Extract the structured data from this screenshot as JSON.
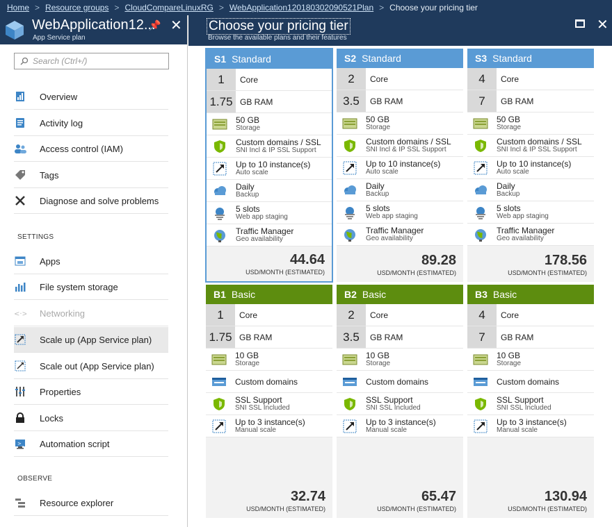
{
  "breadcrumb": {
    "items": [
      "Home",
      "Resource groups",
      "CloudCompareLinuxRG",
      "WebApplication120180302090521Plan"
    ],
    "current": "Choose your pricing tier"
  },
  "left_panel": {
    "title": "WebApplication12...",
    "subtitle": "App Service plan",
    "search_placeholder": "Search (Ctrl+/)",
    "nav": [
      "Overview",
      "Activity log",
      "Access control (IAM)",
      "Tags",
      "Diagnose and solve problems"
    ],
    "settings_label": "SETTINGS",
    "settings": [
      "Apps",
      "File system storage",
      "Networking",
      "Scale up (App Service plan)",
      "Scale out (App Service plan)",
      "Properties",
      "Locks",
      "Automation script"
    ],
    "observe_label": "OBSERVE",
    "observe": [
      "Resource explorer"
    ]
  },
  "right_panel": {
    "title": "Choose your pricing tier",
    "subtitle": "Browse the available plans and their features"
  },
  "colors": {
    "standard": "#5a9bd5",
    "basic": "#5d8d0f",
    "header": "#1f3a5c"
  },
  "standard_features": [
    {
      "t1": "Custom domains / SSL",
      "t2": "SNI Incl & IP SSL Support",
      "icon": "shield-icon"
    },
    {
      "t1": "Up to 10 instance(s)",
      "t2": "Auto scale",
      "icon": "scale-icon"
    },
    {
      "t1": "Daily",
      "t2": "Backup",
      "icon": "cloud-backup-icon"
    },
    {
      "t1": "5 slots",
      "t2": "Web app staging",
      "icon": "slots-icon"
    },
    {
      "t1": "Traffic Manager",
      "t2": "Geo availability",
      "icon": "globe-icon"
    }
  ],
  "basic_features": [
    {
      "t1": "Custom domains",
      "t2": "",
      "icon": "domain-icon"
    },
    {
      "t1": "SSL Support",
      "t2": "SNI SSL Included",
      "icon": "shield-icon"
    },
    {
      "t1": "Up to 3 instance(s)",
      "t2": "Manual scale",
      "icon": "scale-icon"
    }
  ],
  "tiers": [
    {
      "code": "S1",
      "name": "Standard",
      "core": "1",
      "core_label": "Core",
      "ram": "1.75",
      "ram_label": "GB RAM",
      "storage": "50 GB",
      "storage_label": "Storage",
      "price": "44.64",
      "per": "USD/MONTH (ESTIMATED)"
    },
    {
      "code": "S2",
      "name": "Standard",
      "core": "2",
      "core_label": "Core",
      "ram": "3.5",
      "ram_label": "GB RAM",
      "storage": "50 GB",
      "storage_label": "Storage",
      "price": "89.28",
      "per": "USD/MONTH (ESTIMATED)"
    },
    {
      "code": "S3",
      "name": "Standard",
      "core": "4",
      "core_label": "Core",
      "ram": "7",
      "ram_label": "GB RAM",
      "storage": "50 GB",
      "storage_label": "Storage",
      "price": "178.56",
      "per": "USD/MONTH (ESTIMATED)"
    },
    {
      "code": "B1",
      "name": "Basic",
      "core": "1",
      "core_label": "Core",
      "ram": "1.75",
      "ram_label": "GB RAM",
      "storage": "10 GB",
      "storage_label": "Storage",
      "price": "32.74",
      "per": "USD/MONTH (ESTIMATED)"
    },
    {
      "code": "B2",
      "name": "Basic",
      "core": "2",
      "core_label": "Core",
      "ram": "3.5",
      "ram_label": "GB RAM",
      "storage": "10 GB",
      "storage_label": "Storage",
      "price": "65.47",
      "per": "USD/MONTH (ESTIMATED)"
    },
    {
      "code": "B3",
      "name": "Basic",
      "core": "4",
      "core_label": "Core",
      "ram": "7",
      "ram_label": "GB RAM",
      "storage": "10 GB",
      "storage_label": "Storage",
      "price": "130.94",
      "per": "USD/MONTH (ESTIMATED)"
    }
  ]
}
